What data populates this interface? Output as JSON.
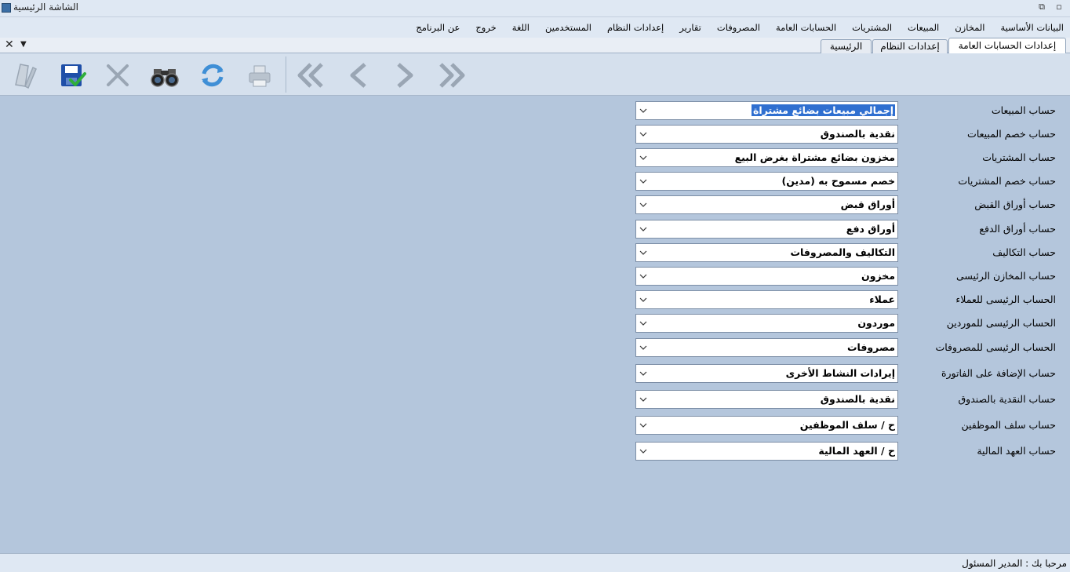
{
  "window": {
    "title": "الشاشة الرئيسية",
    "restore_glyph": "⧉",
    "maximize_glyph": "▫"
  },
  "menu": [
    "البيانات الأساسية",
    "المخازن",
    "المبيعات",
    "المشتريات",
    "الحسابات العامة",
    "المصروفات",
    "تقارير",
    "إعدادات النظام",
    "المستخدمين",
    "اللغة",
    "خروج",
    "عن البرنامج"
  ],
  "tabs": {
    "close_glyph": "✕",
    "dropdown_glyph": "▼",
    "items": [
      {
        "label": "إعدادات الحسابات العامة",
        "active": true
      },
      {
        "label": "إعدادات النظام",
        "active": false
      },
      {
        "label": "الرئيسية",
        "active": false
      }
    ]
  },
  "toolbar": {
    "icons": [
      "edit-icon",
      "save-icon",
      "delete-icon",
      "search-icon",
      "refresh-icon",
      "print-icon",
      "first-record-icon",
      "previous-record-icon",
      "next-record-icon",
      "last-record-icon"
    ],
    "colors": {
      "save": "#1f4fa8",
      "check": "#2fae3a",
      "binoculars": "#333333",
      "refresh": "#3f8fd6",
      "disabled": "#9aa6b4"
    }
  },
  "form": {
    "fields": [
      {
        "label": "حساب المبيعات",
        "value": "إجمالي مبيعات بضائع مشتراة",
        "selected": true
      },
      {
        "label": "حساب خصم المبيعات",
        "value": "نقدية بالصندوق"
      },
      {
        "label": "حساب المشتريات",
        "value": "مخزون بضائع مشتراة بغرض البيع"
      },
      {
        "label": "حساب خصم المشتريات",
        "value": "خصم مسموح به (مدين)"
      },
      {
        "label": "حساب أوراق القبض",
        "value": "أوراق قبض"
      },
      {
        "label": "حساب أوراق الدفع",
        "value": "أوراق دفع"
      },
      {
        "label": "حساب التكاليف",
        "value": "التكاليف والمصروفات"
      },
      {
        "label": "حساب المخازن الرئيسى",
        "value": "مخزون"
      },
      {
        "label": "الحساب الرئيسى للعملاء",
        "value": "عملاء"
      },
      {
        "label": "الحساب الرئيسى للموردين",
        "value": "موردون"
      },
      {
        "label": "الحساب الرئيسى للمصروفات",
        "value": "مصروفات"
      },
      {
        "label": "حساب الإضافة على الفاتورة",
        "value": "إيرادات النشاط الأخرى"
      },
      {
        "label": "حساب النقدية بالصندوق",
        "value": "نقدية بالصندوق"
      },
      {
        "label": "حساب سلف الموظفين",
        "value": "ح / سلف الموظفين"
      },
      {
        "label": "حساب العهد المالية",
        "value": "ح / العهد المالية"
      }
    ]
  },
  "status": {
    "greeting": "مرحبا بك :",
    "user": "المدير المسئول"
  }
}
